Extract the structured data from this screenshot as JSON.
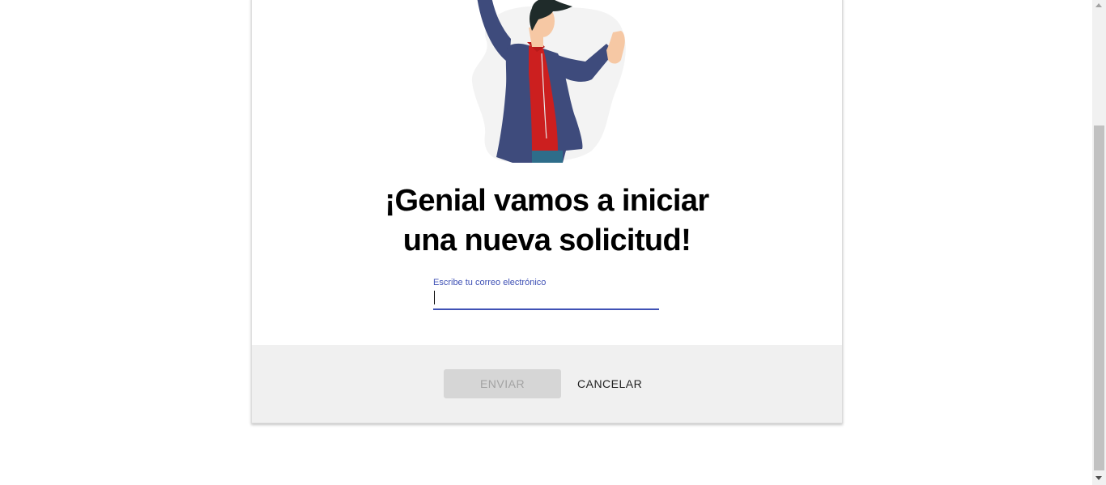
{
  "dialog": {
    "title_line1": "¡Genial vamos a iniciar",
    "title_line2": "una nueva solicitud!",
    "email_field": {
      "label": "Escribe tu correo electrónico",
      "value": ""
    },
    "send_label": "ENVIAR",
    "cancel_label": "CANCELAR"
  },
  "colors": {
    "accent": "#3f51b5",
    "footer_bg": "#f0f0f0",
    "disabled_button": "#d6d6d6"
  },
  "icons": {
    "illustration": "person-celebrating-illustration"
  }
}
